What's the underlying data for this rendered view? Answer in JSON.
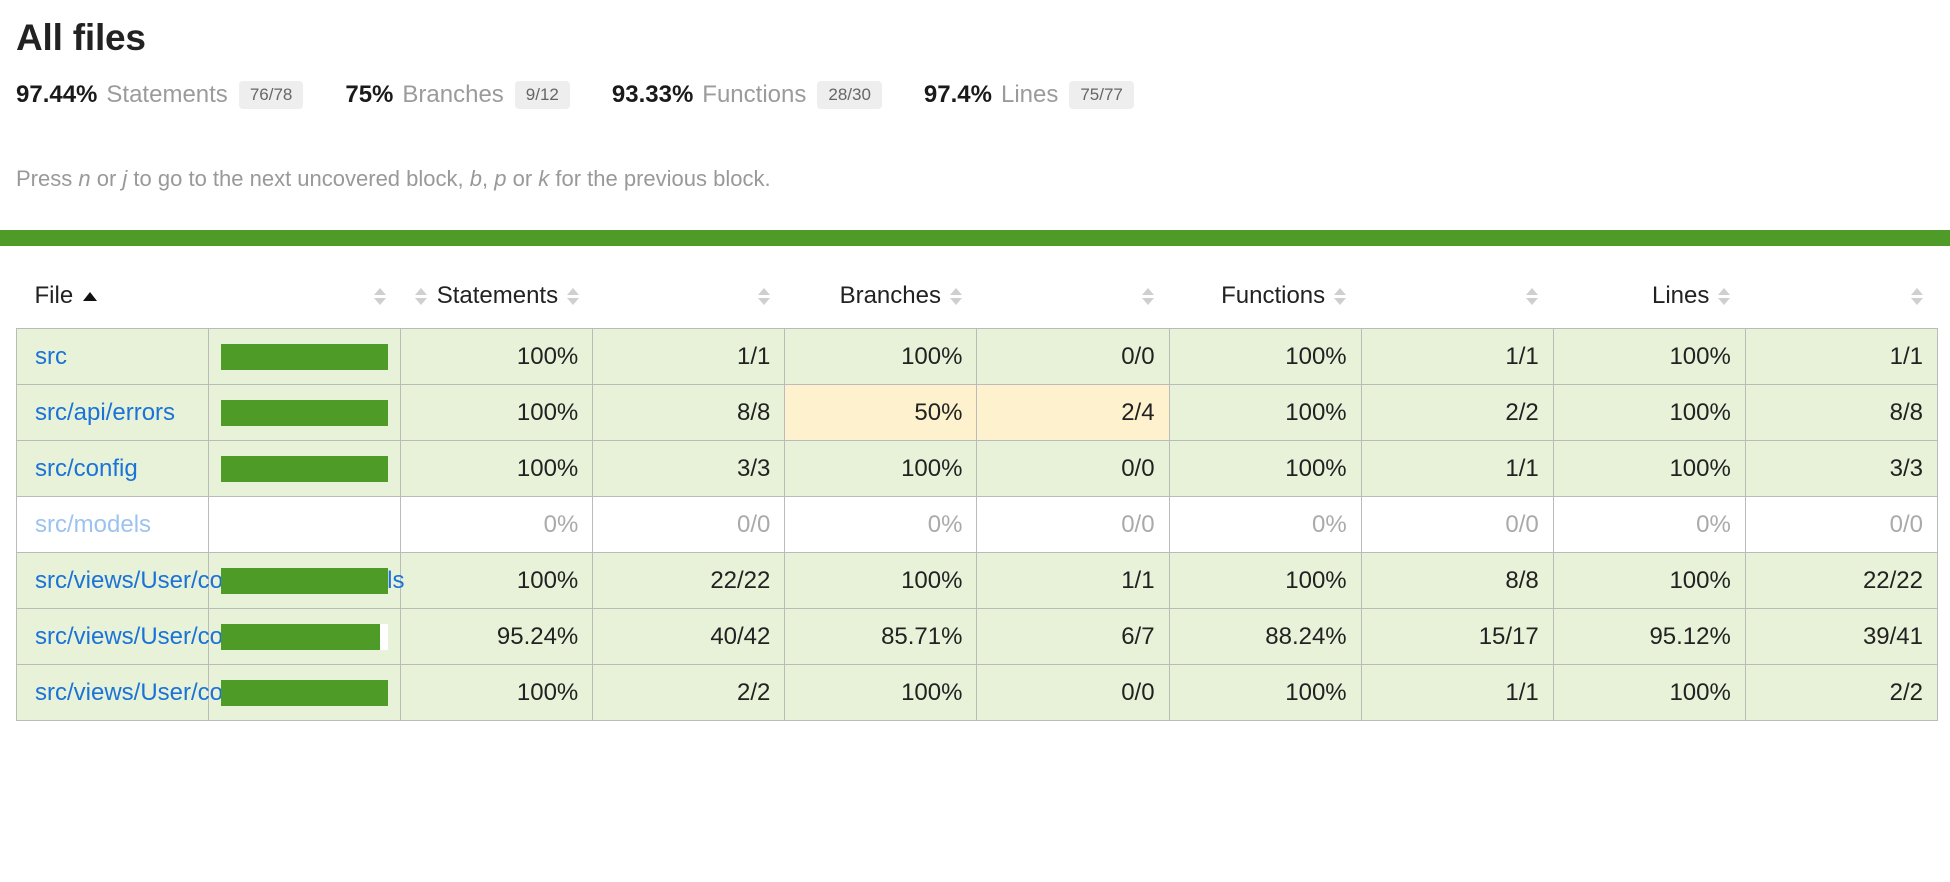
{
  "header": {
    "title": "All files",
    "summary": [
      {
        "pct": "97.44%",
        "label": "Statements",
        "fraction": "76/78"
      },
      {
        "pct": "75%",
        "label": "Branches",
        "fraction": "9/12"
      },
      {
        "pct": "93.33%",
        "label": "Functions",
        "fraction": "28/30"
      },
      {
        "pct": "97.4%",
        "label": "Lines",
        "fraction": "75/77"
      }
    ],
    "help_parts": {
      "p1": "Press ",
      "k1": "n",
      "p2": " or ",
      "k2": "j",
      "p3": " to go to the next uncovered block, ",
      "k3": "b",
      "p4": ", ",
      "k4": "p",
      "p5": " or ",
      "k5": "k",
      "p6": " for the previous block."
    },
    "status_color": "#4f9b28"
  },
  "table": {
    "columns": [
      {
        "label": "File",
        "sorted": "asc",
        "sort_glyph": "▲"
      },
      {
        "label": ""
      },
      {
        "label": "Statements"
      },
      {
        "label": ""
      },
      {
        "label": "Branches"
      },
      {
        "label": ""
      },
      {
        "label": "Functions"
      },
      {
        "label": ""
      },
      {
        "label": "Lines"
      },
      {
        "label": ""
      }
    ],
    "rows": [
      {
        "file": "src",
        "state": "high",
        "bar_pct": 100,
        "statements_pct": "100%",
        "statements_raw": "1/1",
        "statements_state": "high",
        "branches_pct": "100%",
        "branches_raw": "0/0",
        "branches_state": "high",
        "functions_pct": "100%",
        "functions_raw": "1/1",
        "functions_state": "high",
        "lines_pct": "100%",
        "lines_raw": "1/1",
        "lines_state": "high"
      },
      {
        "file": "src/api/errors",
        "state": "high",
        "bar_pct": 100,
        "statements_pct": "100%",
        "statements_raw": "8/8",
        "statements_state": "high",
        "branches_pct": "50%",
        "branches_raw": "2/4",
        "branches_state": "medium",
        "functions_pct": "100%",
        "functions_raw": "2/2",
        "functions_state": "high",
        "lines_pct": "100%",
        "lines_raw": "8/8",
        "lines_state": "high"
      },
      {
        "file": "src/config",
        "state": "high",
        "bar_pct": 100,
        "statements_pct": "100%",
        "statements_raw": "3/3",
        "statements_state": "high",
        "branches_pct": "100%",
        "branches_raw": "0/0",
        "branches_state": "high",
        "functions_pct": "100%",
        "functions_raw": "1/1",
        "functions_state": "high",
        "lines_pct": "100%",
        "lines_raw": "3/3",
        "lines_state": "high"
      },
      {
        "file": "src/models",
        "state": "empty",
        "bar_pct": 0,
        "statements_pct": "0%",
        "statements_raw": "0/0",
        "statements_state": "empty",
        "branches_pct": "0%",
        "branches_raw": "0/0",
        "branches_state": "empty",
        "functions_pct": "0%",
        "functions_raw": "0/0",
        "functions_state": "empty",
        "lines_pct": "0%",
        "lines_raw": "0/0",
        "lines_state": "empty"
      },
      {
        "file": "src/views/User/components/details",
        "state": "high",
        "bar_pct": 100,
        "statements_pct": "100%",
        "statements_raw": "22/22",
        "statements_state": "high",
        "branches_pct": "100%",
        "branches_raw": "1/1",
        "branches_state": "high",
        "functions_pct": "100%",
        "functions_raw": "8/8",
        "functions_state": "high",
        "lines_pct": "100%",
        "lines_raw": "22/22",
        "lines_state": "high"
      },
      {
        "file": "src/views/User/components/list",
        "state": "high",
        "bar_pct": 95.24,
        "statements_pct": "95.24%",
        "statements_raw": "40/42",
        "statements_state": "high",
        "branches_pct": "85.71%",
        "branches_raw": "6/7",
        "branches_state": "high",
        "functions_pct": "88.24%",
        "functions_raw": "15/17",
        "functions_state": "high",
        "lines_pct": "95.12%",
        "lines_raw": "39/41",
        "lines_state": "high"
      },
      {
        "file": "src/views/User/config",
        "state": "high",
        "bar_pct": 100,
        "statements_pct": "100%",
        "statements_raw": "2/2",
        "statements_state": "high",
        "branches_pct": "100%",
        "branches_raw": "0/0",
        "branches_state": "high",
        "functions_pct": "100%",
        "functions_raw": "1/1",
        "functions_state": "high",
        "lines_pct": "100%",
        "lines_raw": "2/2",
        "lines_state": "high"
      }
    ]
  },
  "colors": {
    "high_bg": "#e8f2d9",
    "medium_bg": "#fdf2cd",
    "bar": "#4f9b28",
    "link": "#1a73d6",
    "link_muted": "#9cc3f0"
  }
}
